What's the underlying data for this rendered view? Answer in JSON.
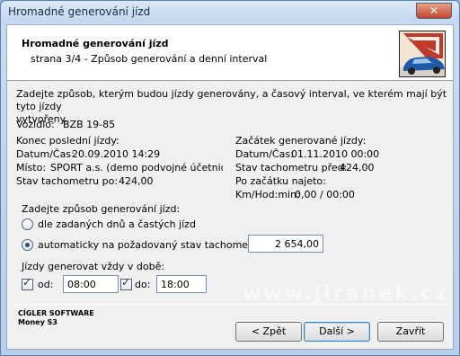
{
  "window": {
    "title": "Hromadné generování jízd"
  },
  "header": {
    "title": "Hromadné generování jízd",
    "subtitle": "strana 3/4 - Způsob generování a denní interval"
  },
  "intro": {
    "line1": "Zadejte způsob, kterým budou jízdy generovány, a časový interval, ve kterém mají být tyto jízdy",
    "line2": "vytvořeny."
  },
  "vehicle": {
    "label": "Vozidlo:",
    "value": "BZB 19-85"
  },
  "last_trip": {
    "heading": "Konec poslední jízdy:",
    "datetime_label": "Datum/Čas:",
    "datetime_value": "20.09.2010  14:29",
    "place_label": "Místo:",
    "place_value": "SPORT a.s. (demo podvojné účetnictví, sk",
    "odometer_label": "Stav tachometru po:",
    "odometer_value": "424,00"
  },
  "new_trip": {
    "heading": "Začátek generované jízdy:",
    "datetime_label": "Datum/Čas:",
    "datetime_value": "01.11.2010  00:00",
    "odometer_label": "Stav tachometru před:",
    "odometer_value": "424,00",
    "since_start_label": "Po začátku najeto:",
    "kmh_label": "Km/Hod:min:",
    "kmh_value": "0,00 / 00:00"
  },
  "method": {
    "heading": "Zadejte způsob generování jízd:",
    "option1": "dle zadaných dnů a častých jízd",
    "option2": "automaticky na požadovaný stav tachometru",
    "selected": "option2",
    "odometer_target": "2 654,00"
  },
  "time_window": {
    "heading": "Jízdy generovat vždy v době:",
    "from_label": "od:",
    "from_value": "08:00",
    "from_checked": true,
    "to_label": "do:",
    "to_value": "18:00",
    "to_checked": true
  },
  "brand": {
    "line1": "CÍGLER SOFTWARE",
    "line2": "Money S3"
  },
  "watermark": "www.jiranek.cz",
  "buttons": {
    "back": "< Zpět",
    "next": "Další >",
    "close": "Zavřít"
  },
  "titlebar_buttons": {
    "close_glyph": "✕"
  }
}
